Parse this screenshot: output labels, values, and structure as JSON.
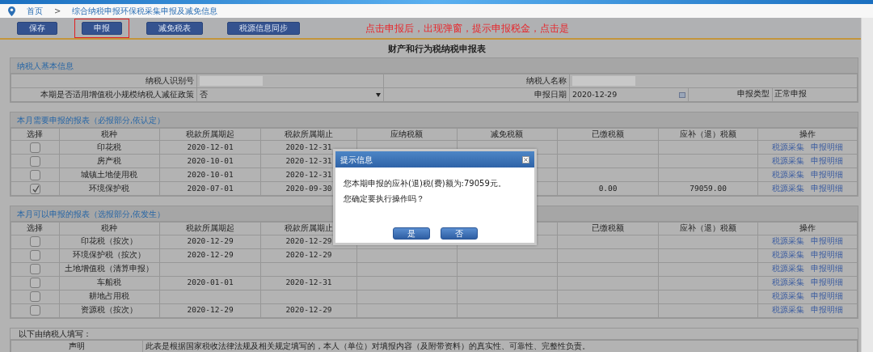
{
  "breadcrumb": {
    "items": [
      {
        "text": "首页"
      },
      {
        "text": "综合纳税申报环保税采集申报及减免信息"
      }
    ],
    "separator": ">"
  },
  "toolbar": {
    "buttons": [
      {
        "label": "保存",
        "highlighted": false
      },
      {
        "label": "申报",
        "highlighted": true
      },
      {
        "label": "减免税表",
        "highlighted": false
      },
      {
        "label": "税源信息同步",
        "highlighted": false
      }
    ],
    "note": "点击申报后，出现弹窗，提示申报税金，点击是"
  },
  "form_title": "财产和行为税纳税申报表",
  "basic_info": {
    "title": "纳税人基本信息",
    "taxpayer_id_label": "纳税人识别号",
    "taxpayer_name_label": "纳税人名称",
    "policy_label": "本期是否适用增值税小规模纳税人减征政策",
    "policy_value": "否",
    "date_label": "申报日期",
    "date_value": "2020-12-29",
    "type_label": "申报类型",
    "type_value": "正常申报"
  },
  "sections": [
    {
      "title": "本月需要申报的报表（必报部分,依认定）",
      "columns": [
        "选择",
        "税种",
        "税款所属期起",
        "税款所属期止",
        "应纳税额",
        "减免税额",
        "已缴税额",
        "应补（退）税额",
        "操作"
      ],
      "rows": [
        {
          "checked": false,
          "tax": "印花税",
          "start": "2020-12-01",
          "end": "2020-12-31",
          "paid": "",
          "due": "",
          "actions": [
            "税源采集",
            "申报明细"
          ]
        },
        {
          "checked": false,
          "tax": "房产税",
          "start": "2020-10-01",
          "end": "2020-12-31",
          "paid": "",
          "due": "",
          "actions": [
            "税源采集",
            "申报明细"
          ]
        },
        {
          "checked": false,
          "tax": "城镇土地使用税",
          "start": "2020-10-01",
          "end": "2020-12-31",
          "paid": "",
          "due": "",
          "actions": [
            "税源采集",
            "申报明细"
          ]
        },
        {
          "checked": true,
          "tax": "环境保护税",
          "start": "2020-07-01",
          "end": "2020-09-30",
          "paid": "0.00",
          "due": "79059.00",
          "actions": [
            "税源采集",
            "申报明细"
          ]
        }
      ]
    },
    {
      "title": "本月可以申报的报表（选报部分,依发生）",
      "columns": [
        "选择",
        "税种",
        "税款所属期起",
        "税款所属期止",
        null,
        null,
        "已缴税额",
        "应补（退）税额",
        "操作"
      ],
      "rows": [
        {
          "checked": false,
          "tax": "印花税（按次）",
          "start": "2020-12-29",
          "end": "2020-12-29",
          "paid": "",
          "due": "",
          "actions": [
            "税源采集",
            "申报明细"
          ]
        },
        {
          "checked": false,
          "tax": "环境保护税（按次）",
          "start": "2020-12-29",
          "end": "2020-12-29",
          "paid": "",
          "due": "",
          "actions": [
            "税源采集",
            "申报明细"
          ]
        },
        {
          "checked": false,
          "tax": "土地增值税（清算申报）",
          "start": "",
          "end": "",
          "paid": "",
          "due": "",
          "actions": [
            "税源采集",
            "申报明细"
          ]
        },
        {
          "checked": false,
          "tax": "车船税",
          "start": "2020-01-01",
          "end": "2020-12-31",
          "paid": "",
          "due": "",
          "actions": [
            "税源采集",
            "申报明细"
          ]
        },
        {
          "checked": false,
          "tax": "耕地占用税",
          "start": "",
          "end": "",
          "paid": "",
          "due": "",
          "actions": [
            "税源采集",
            "申报明细"
          ]
        },
        {
          "checked": false,
          "tax": "资源税（按次）",
          "start": "2020-12-29",
          "end": "2020-12-29",
          "paid": "",
          "due": "",
          "actions": [
            "税源采集",
            "申报明细"
          ]
        }
      ]
    }
  ],
  "declaration": {
    "title": "以下由纳税人填写：",
    "label": "声明",
    "text": "此表是根据国家税收法律法规及相关规定填写的，本人（单位）对填报内容（及附带资料）的真实性、可靠性、完整性负责。"
  },
  "dialog": {
    "title": "提示信息",
    "lines": [
      "您本期申报的应补(退)税(费)额为:79059元。",
      "您确定要执行操作吗？"
    ],
    "buttons": [
      "是",
      "否"
    ]
  }
}
